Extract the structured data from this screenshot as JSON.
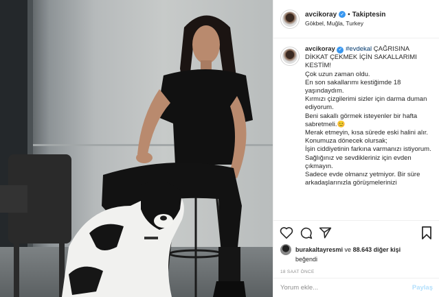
{
  "header": {
    "username": "avcikoray",
    "follow_status": "Takiptesin",
    "separator": "•",
    "location": "Gökbel, Muğla, Turkey",
    "verified_icon": "verified-badge-icon"
  },
  "caption": {
    "username": "avcikoray",
    "hashtag": "#evdekal",
    "headline_rest": " ÇAĞRISINA DİKKAT ÇEKMEK İÇİN SAKALLARIMI KESTİM!",
    "lines": [
      "Çok uzun zaman oldu.",
      "En son sakallarımı kestiğimde 18 yaşındaydım.",
      "Kırmızı çizgilerimi sizler için darma duman ediyorum.",
      "Beni sakallı görmek isteyenler bir hafta sabretmeli.😊",
      "Merak etmeyin, kısa sürede eski halini alır.",
      "Konumuza dönecek olursak;",
      "İşin ciddiyetinin farkına varmanızı istiyorum.",
      "Sağlığınız ve sevdikleriniz için evden çıkmayın.",
      "Sadece evde olmanız yetmiyor. Bir süre arkadaşlarınızla görüşmelerinizi"
    ]
  },
  "actions": {
    "like_icon": "heart-icon",
    "comment_icon": "comment-bubble-icon",
    "share_icon": "paper-plane-icon",
    "save_icon": "bookmark-icon"
  },
  "likes": {
    "liker": "burakaltayresmi",
    "connector": " ve ",
    "others": "88.643 diğer kişi",
    "liked_word": "beğendi"
  },
  "time": "18 SAAT ÖNCE",
  "comment": {
    "placeholder": "Yorum ekle...",
    "post_label": "Paylaş"
  },
  "colors": {
    "verified": "#3897f0",
    "hashtag": "#00376b",
    "post_button_disabled": "#b2dffc",
    "secondary_text": "#8e8e8e"
  }
}
